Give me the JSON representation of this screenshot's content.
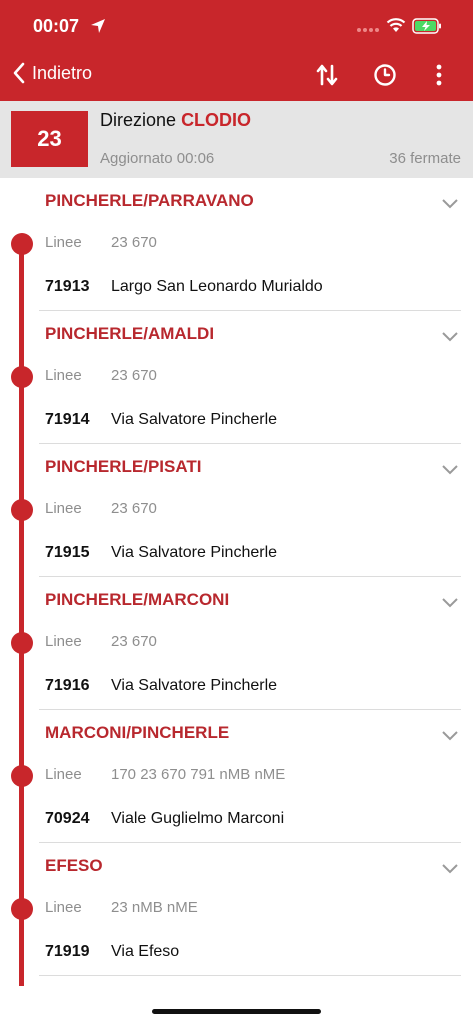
{
  "status_bar": {
    "time": "00:07"
  },
  "toolbar": {
    "back_label": "Indietro",
    "icons": [
      "swap-direction-icon",
      "clock-icon",
      "more-vertical-icon"
    ]
  },
  "route": {
    "number": "23",
    "direction_prefix": "Direzione",
    "destination": "CLODIO",
    "updated": "Aggiornato 00:06",
    "stop_count": "36 fermate"
  },
  "colors": {
    "accent": "#c8262b",
    "stop_name": "#b8282e",
    "header_bg": "#e5e5e5",
    "muted": "#8e8e8e"
  },
  "stops": [
    {
      "name": "PINCHERLE/PARRAVANO",
      "linee_label": "Linee",
      "lines": "23 670",
      "code": "71913",
      "street": "Largo San Leonardo Murialdo"
    },
    {
      "name": "PINCHERLE/AMALDI",
      "linee_label": "Linee",
      "lines": "23 670",
      "code": "71914",
      "street": "Via Salvatore Pincherle"
    },
    {
      "name": "PINCHERLE/PISATI",
      "linee_label": "Linee",
      "lines": "23 670",
      "code": "71915",
      "street": "Via Salvatore Pincherle"
    },
    {
      "name": "PINCHERLE/MARCONI",
      "linee_label": "Linee",
      "lines": "23 670",
      "code": "71916",
      "street": "Via Salvatore Pincherle"
    },
    {
      "name": "MARCONI/PINCHERLE",
      "linee_label": "Linee",
      "lines": "170 23 670 791 nMB nME",
      "code": "70924",
      "street": "Viale Guglielmo Marconi"
    },
    {
      "name": "EFESO",
      "linee_label": "Linee",
      "lines": "23 nMB nME",
      "code": "71919",
      "street": "Via Efeso"
    }
  ]
}
